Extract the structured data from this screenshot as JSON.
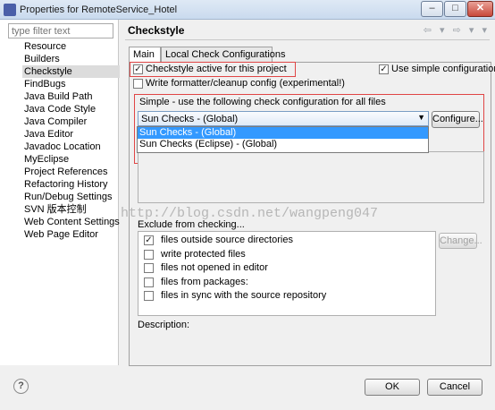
{
  "window": {
    "title": "Properties for RemoteService_Hotel",
    "min_label": "–",
    "max_label": "□",
    "close_label": "✕",
    "app_icon": "eclipse-app-icon"
  },
  "filter": {
    "placeholder": "type filter text"
  },
  "nav": {
    "items": [
      "Resource",
      "Builders",
      "Checkstyle",
      "FindBugs",
      "Java Build Path",
      "Java Code Style",
      "Java Compiler",
      "Java Editor",
      "Javadoc Location",
      "MyEclipse",
      "Project References",
      "Refactoring History",
      "Run/Debug Settings",
      "SVN 版本控制",
      "Web Content Settings",
      "Web Page Editor"
    ],
    "selected": "Checkstyle"
  },
  "page": {
    "title": "Checkstyle",
    "nav_arrows": "⇦ ▾ ⇨ ▾ ▾"
  },
  "tabs": {
    "main": "Main",
    "local": "Local Check Configurations"
  },
  "options": {
    "active_label": "Checkstyle active for this project",
    "active_checked": true,
    "formatter_label": "Write formatter/cleanup config (experimental!)",
    "formatter_checked": false,
    "simple_label": "Use simple configuration",
    "simple_checked": true
  },
  "simple_group": {
    "title": "Simple - use the following check configuration for all files",
    "selected": "Sun Checks  - (Global)",
    "options": [
      "Sun Checks  - (Global)",
      "Sun Checks (Eclipse)  - (Global)"
    ],
    "configure_label": "Configure..."
  },
  "exclude": {
    "title": "Exclude from checking...",
    "change_label": "Change...",
    "items": [
      {
        "label": "files outside source directories",
        "checked": true
      },
      {
        "label": "write protected files",
        "checked": false
      },
      {
        "label": "files not opened in editor",
        "checked": false
      },
      {
        "label": "files from packages:",
        "checked": false
      },
      {
        "label": "files in sync with the source repository",
        "checked": false
      }
    ]
  },
  "description": {
    "label": "Description:"
  },
  "watermark": "http://blog.csdn.net/wangpeng047",
  "footer": {
    "help_label": "?",
    "ok_label": "OK",
    "cancel_label": "Cancel"
  },
  "colors": {
    "highlight": "#e04545",
    "selection": "#3399ff"
  }
}
